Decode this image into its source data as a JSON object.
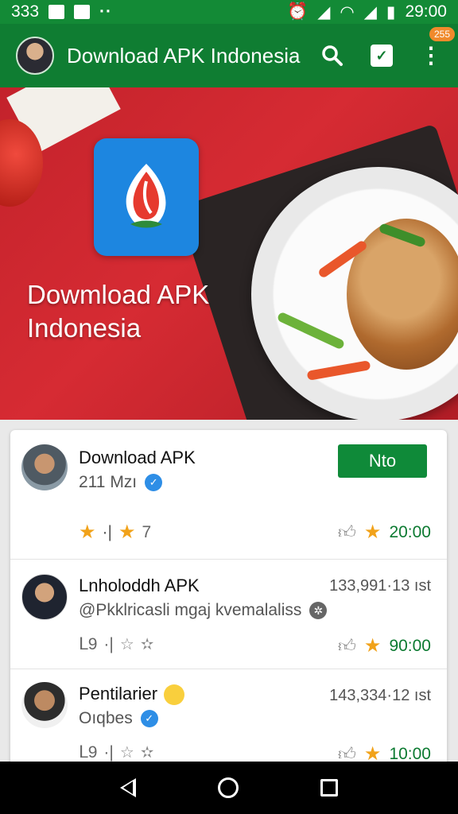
{
  "status_bar": {
    "left_text": "333",
    "time": "29:00"
  },
  "app_bar": {
    "title": "Download APK Indonesia",
    "badge_count": "255",
    "icons": [
      "search-icon",
      "shield-icon",
      "more-vert-icon"
    ]
  },
  "hero": {
    "title_line1": "Dowmload APK",
    "title_line2": "Indonesia"
  },
  "items": [
    {
      "name": "Download APK",
      "sub": "211 Mzı",
      "action_label": "Nto",
      "stat_left": "7",
      "stat_right": "20:00"
    },
    {
      "name": "Lnholoddh APK",
      "sub": "@Pkklricasli mgaj kvemalaliss",
      "meta": "133,991·13 ıst",
      "stat_right": "90:00"
    },
    {
      "name": "Pentilarier",
      "sub": "Oıqbes",
      "meta": "143,334·12 ıst",
      "stat_right": "10:00"
    }
  ],
  "colors": {
    "app_bar": "#0f7d32",
    "accent_green": "#0f8a39",
    "hero_red": "#d62b33",
    "star": "#f1a21a",
    "badge": "#f08a2c"
  }
}
